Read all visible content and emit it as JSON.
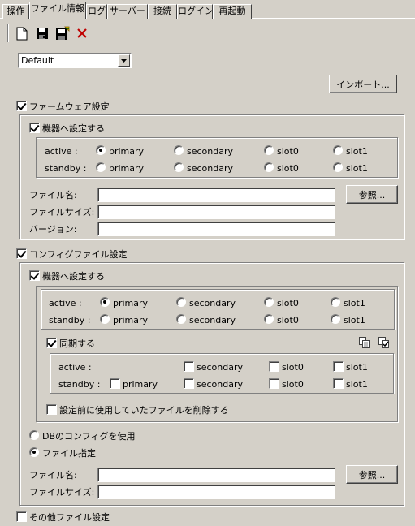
{
  "tabs": [
    "操作",
    "ファイル情報",
    "ログ",
    "サーバー",
    "接続",
    "ログイン",
    "再起動"
  ],
  "active_tab": "ファイル情報",
  "toolbar": {
    "icons": [
      "new-file-icon",
      "save-icon",
      "save-as-icon",
      "delete-icon"
    ]
  },
  "profile_select": {
    "value": "Default"
  },
  "import_button": "インポート...",
  "firmware": {
    "section_label": "ファームウェア設定",
    "apply_label": "機器へ設定する",
    "active_label": "active :",
    "standby_label": "standby :",
    "options": [
      "primary",
      "secondary",
      "slot0",
      "slot1"
    ],
    "file_name_label": "ファイル名:",
    "file_size_label": "ファイルサイズ:",
    "version_label": "バージョン:",
    "browse_button": "参照..."
  },
  "config": {
    "section_label": "コンフィグファイル設定",
    "apply_label": "機器へ設定する",
    "active_label": "active :",
    "standby_label": "standby :",
    "options": [
      "primary",
      "secondary",
      "slot0",
      "slot1"
    ],
    "sync_label": "同期する",
    "sync_active_label": "active :",
    "sync_standby_label": "standby :",
    "delete_label": "設定前に使用していたファイルを削除する",
    "db_config_label": "DBのコンフィグを使用",
    "file_specify_label": "ファイル指定",
    "file_name_label": "ファイル名:",
    "file_size_label": "ファイルサイズ:",
    "browse_button": "参照..."
  },
  "other": {
    "section_label": "その他ファイル設定"
  }
}
